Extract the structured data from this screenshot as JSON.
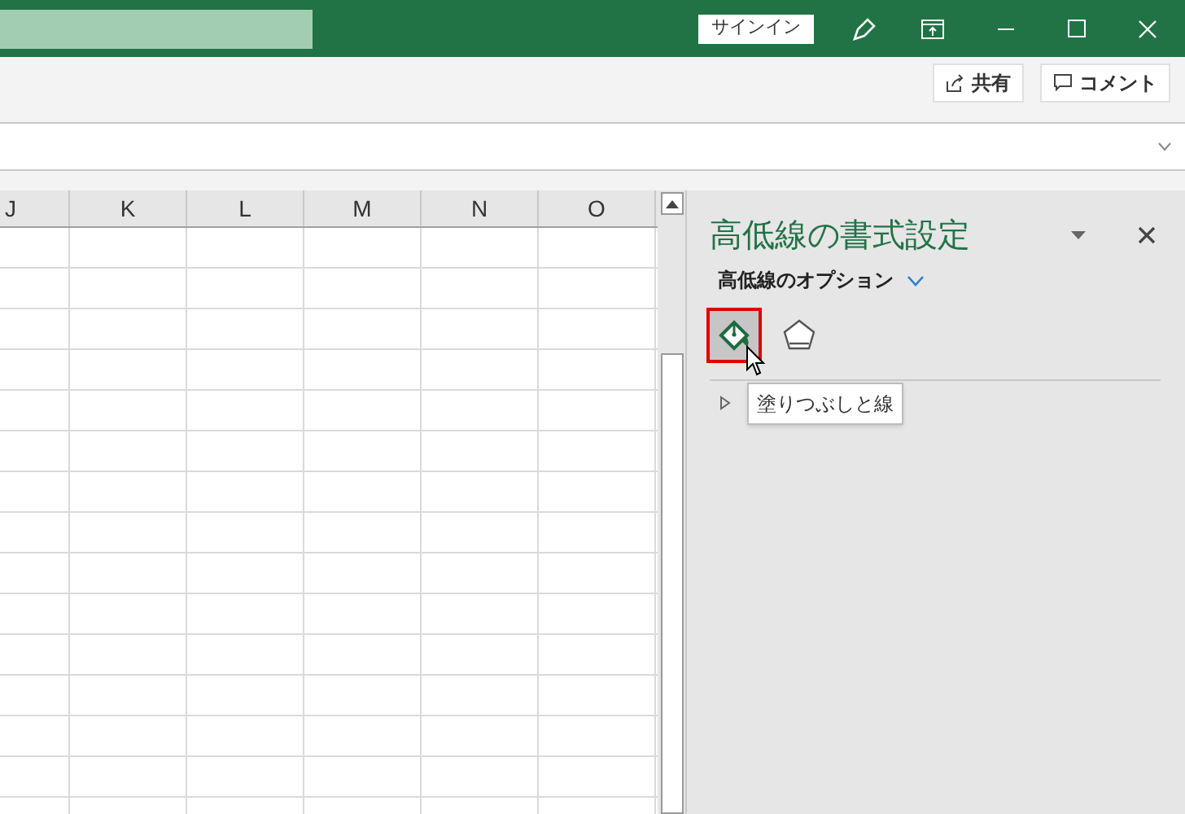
{
  "title_bar": {
    "signin_button": "サインイン"
  },
  "ribbon": {
    "share_button": "共有",
    "comment_button": "コメント"
  },
  "sheet": {
    "columns": [
      "J",
      "K",
      "L",
      "M",
      "N",
      "O"
    ]
  },
  "format_pane": {
    "title": "高低線の書式設定",
    "options_label": "高低線のオプション",
    "tabs": [
      {
        "kind": "fill",
        "selected": true
      },
      {
        "kind": "effects",
        "selected": false
      }
    ],
    "tooltip": "塗りつぶしと線",
    "section": {
      "expanded": false
    }
  }
}
